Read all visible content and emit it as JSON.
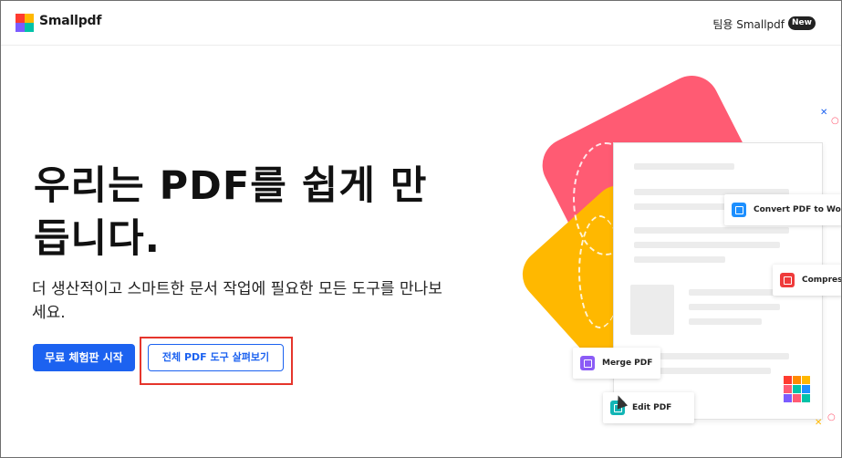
{
  "header": {
    "brand": "Smallpdf",
    "team_link": "팀용 Smallpdf",
    "new_badge": "New"
  },
  "hero": {
    "title_line1": "우리는 PDF를 쉽게 만",
    "title_line2": "듭니다.",
    "subtitle_line1": "더 생산적이고 스마트한 문서 작업에 필요한 모든 도구를 만나보",
    "subtitle_line2": "세요.",
    "primary_button": "무료 체험판 시작",
    "secondary_button": "전체 PDF 도구 살펴보기"
  },
  "tools": {
    "convert": "Convert PDF to Word",
    "compress": "Compress",
    "merge": "Merge PDF",
    "edit": "Edit PDF"
  },
  "colors": {
    "accent": "#1c62f0",
    "highlight": "#e5352c",
    "red_shape": "#ff5b73",
    "yellow_shape": "#ffb800"
  },
  "icons": {
    "logo": "smallpdf-logo-icon",
    "convert": "convert-word-icon",
    "compress": "compress-icon",
    "merge": "merge-icon",
    "edit": "edit-icon"
  }
}
